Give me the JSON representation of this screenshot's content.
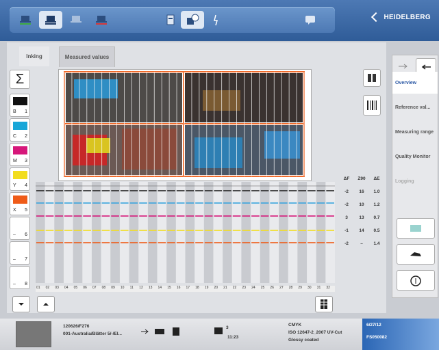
{
  "brand": {
    "name": "HEIDELBERG"
  },
  "tabs": [
    {
      "label": "Inking"
    },
    {
      "label": "Measured values"
    }
  ],
  "ink_keys": [
    {
      "letter": "B",
      "number": "1",
      "color": "#111111"
    },
    {
      "letter": "C",
      "number": "2",
      "color": "#18a6d8"
    },
    {
      "letter": "M",
      "number": "3",
      "color": "#d6177a"
    },
    {
      "letter": "Y",
      "number": "4",
      "color": "#f2dd1e"
    },
    {
      "letter": "X",
      "number": "5",
      "color": "#ef5b18"
    },
    {
      "letter": "–",
      "number": "6",
      "color": "#ffffff"
    },
    {
      "letter": "–",
      "number": "7",
      "color": "#ffffff"
    },
    {
      "letter": "–",
      "number": "8",
      "color": "#ffffff"
    }
  ],
  "right_nav": [
    {
      "label": "Overview",
      "active": true
    },
    {
      "label": "Reference val..."
    },
    {
      "label": "Measuring range"
    },
    {
      "label": "Quality Monitor"
    },
    {
      "label": "Logging",
      "disabled": true
    }
  ],
  "values_table": {
    "headers": [
      "ΔF",
      "Z90",
      "ΔE"
    ],
    "rows": [
      [
        "-2",
        "16",
        "1.0"
      ],
      [
        "-2",
        "10",
        "1.2"
      ],
      [
        "3",
        "13",
        "0.7"
      ],
      [
        "-1",
        "14",
        "0.5"
      ],
      [
        "-2",
        "–",
        "1.4"
      ]
    ]
  },
  "zones": [
    "01",
    "02",
    "03",
    "04",
    "05",
    "06",
    "07",
    "08",
    "09",
    "10",
    "11",
    "12",
    "13",
    "14",
    "15",
    "16",
    "17",
    "18",
    "19",
    "20",
    "21",
    "22",
    "23",
    "24",
    "25",
    "26",
    "27",
    "28",
    "29",
    "30",
    "31",
    "32"
  ],
  "bottom": {
    "job_id": "120626/F276",
    "job_name": "001-Australia/Blätter 5/-/El...",
    "count": "3",
    "time": "11:23",
    "standard_title": "CMYK",
    "standard": "ISO 12647-2_2007 UV-Cut",
    "paper": "Glossy coated",
    "date": "6/27/12",
    "code": "FS050082"
  },
  "colors": {
    "accent": "#2f5c98",
    "active": "#2a57a4"
  }
}
